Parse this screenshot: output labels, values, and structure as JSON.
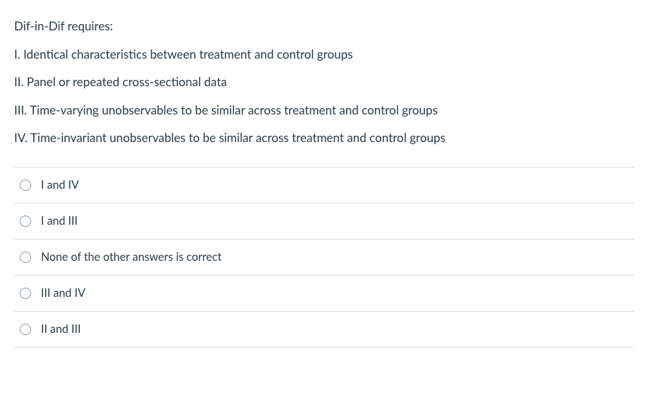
{
  "question": {
    "prompt": "Dif-in-Dif requires:",
    "statements": [
      "I. Identical characteristics between treatment and control groups",
      "II. Panel or repeated cross-sectional data",
      "III. Time-varying unobservables to be similar across treatment and control groups",
      "IV. Time-invariant unobservables to be similar across treatment and control groups"
    ]
  },
  "answers": [
    {
      "label": "I and IV"
    },
    {
      "label": "I and III"
    },
    {
      "label": "None of the other answers is correct"
    },
    {
      "label": "III and IV"
    },
    {
      "label": "II and III"
    }
  ]
}
